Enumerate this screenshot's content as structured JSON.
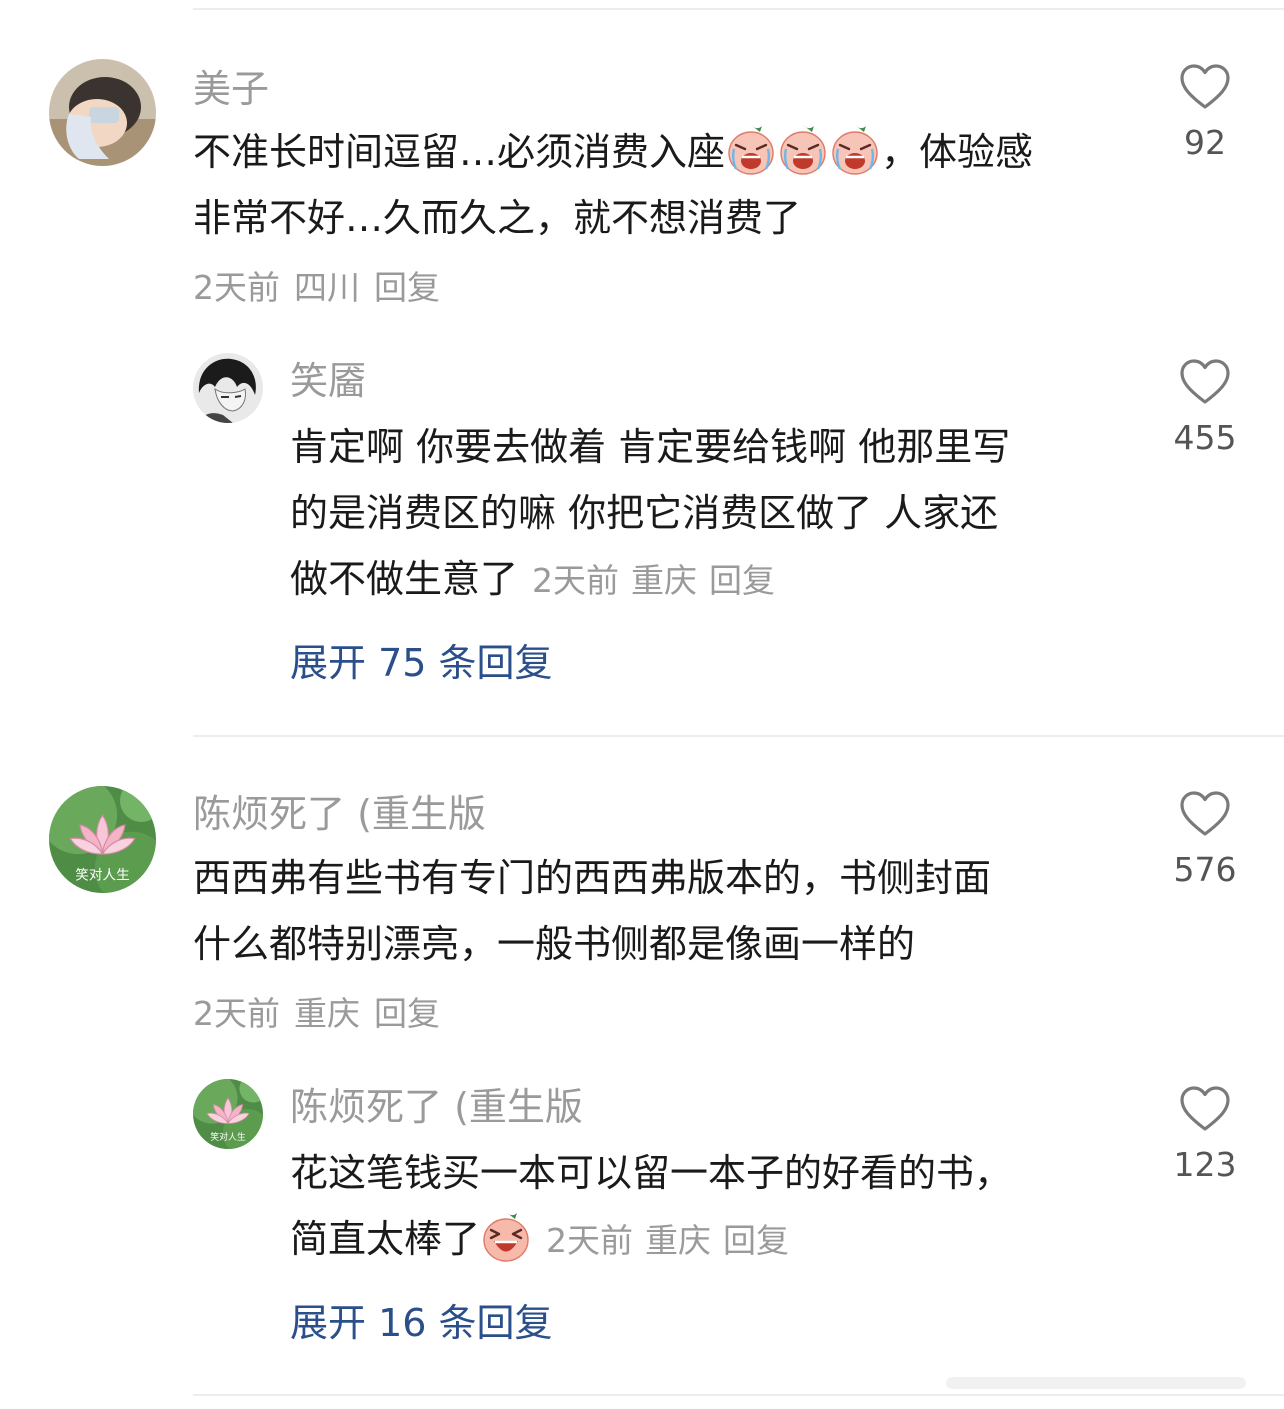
{
  "comments": [
    {
      "username": "美子",
      "text_a": "不准长时间逗留…必须消费入座",
      "text_b": "，体验感",
      "text_c": "非常不好…久而久之，就不想消费了",
      "time": "2天前",
      "location": "四川",
      "reply_label": "回复",
      "likes": "92",
      "emoji_name": "crying-face-icon"
    },
    {
      "username": "笑靥",
      "text_a": "肯定啊 你要去做着 肯定要给钱啊 他那里写",
      "text_b": "的是消费区的嘛 你把它消费区做了 人家还",
      "text_c": "做不做生意了",
      "time": "2天前",
      "location": "重庆",
      "reply_label": "回复",
      "likes": "455",
      "expand_label": "展开 75 条回复"
    },
    {
      "username": "陈烦死了 (重生版",
      "text_a": "西西弗有些书有专门的西西弗版本的，书侧封面",
      "text_b": "什么都特别漂亮，一般书侧都是像画一样的",
      "time": "2天前",
      "location": "重庆",
      "reply_label": "回复",
      "likes": "576",
      "avatar_caption": "笑对人生"
    },
    {
      "username": "陈烦死了 (重生版",
      "text_a": "花这笔钱买一本可以留一本子的好看的书，",
      "text_b": "简直太棒了",
      "time": "2天前",
      "location": "重庆",
      "reply_label": "回复",
      "likes": "123",
      "avatar_caption": "笑对人生",
      "expand_label": "展开 16 条回复",
      "emoji_name": "laughing-face-icon"
    }
  ],
  "colors": {
    "username": "#9a9a9a",
    "expand_link": "#2b4f8a",
    "divider": "#ededed"
  }
}
